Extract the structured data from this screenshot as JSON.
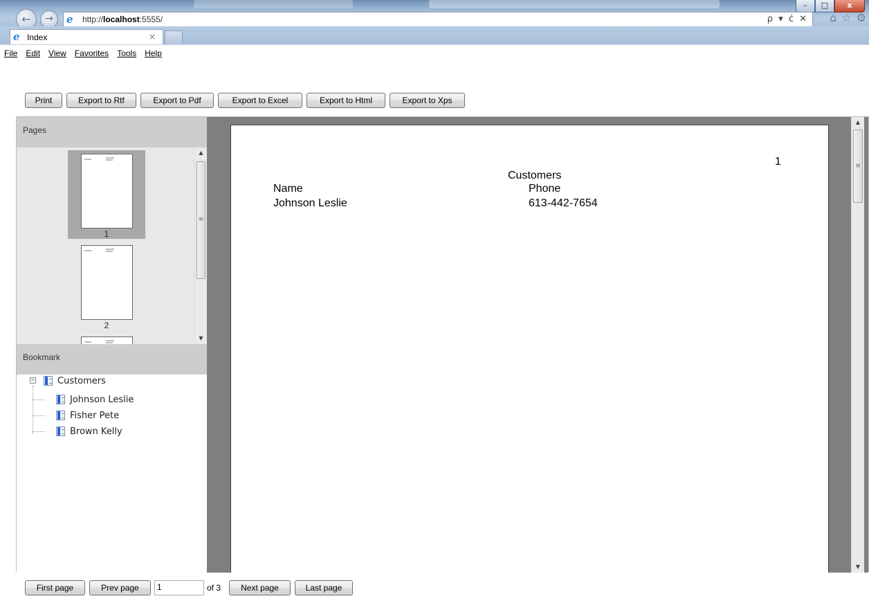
{
  "browser": {
    "url_prefix": "http://",
    "url_host": "localhost",
    "url_suffix": ":5555/",
    "tab_title": "Index",
    "tab_close": "×",
    "address_tools": "ρ ▾ ċ ✕",
    "window_buttons": {
      "minimize": "–",
      "maximize": "□",
      "close": "x"
    },
    "menus": [
      "File",
      "Edit",
      "View",
      "Favorites",
      "Tools",
      "Help"
    ],
    "icons": [
      "home-icon",
      "star-icon",
      "gear-icon"
    ]
  },
  "toolbar": {
    "print": "Print",
    "export_rtf": "Export to Rtf",
    "export_pdf": "Export to Pdf",
    "export_excel": "Export to Excel",
    "export_html": "Export to Html",
    "export_xps": "Export to Xps"
  },
  "pages_panel": {
    "header": "Pages",
    "thumbnails": [
      "1",
      "2"
    ]
  },
  "bookmark_panel": {
    "header": "Bookmark",
    "root": "Customers",
    "children": [
      "Johnson Leslie",
      "Fisher Pete",
      "Brown Kelly"
    ]
  },
  "document": {
    "page_number": "1",
    "title": "Customers",
    "col_name": "Name",
    "col_phone": "Phone",
    "row_name": "Johnson Leslie",
    "row_phone": "613-442-7654"
  },
  "navigation": {
    "first": "First page",
    "prev": "Prev page",
    "current_page": "1",
    "of_total": "of 3",
    "next": "Next page",
    "last": "Last page"
  },
  "colors": {
    "pane_header": "#cdcdcd",
    "doc_background": "#7f7f7f",
    "bookmark_icon": "#2960c8"
  }
}
